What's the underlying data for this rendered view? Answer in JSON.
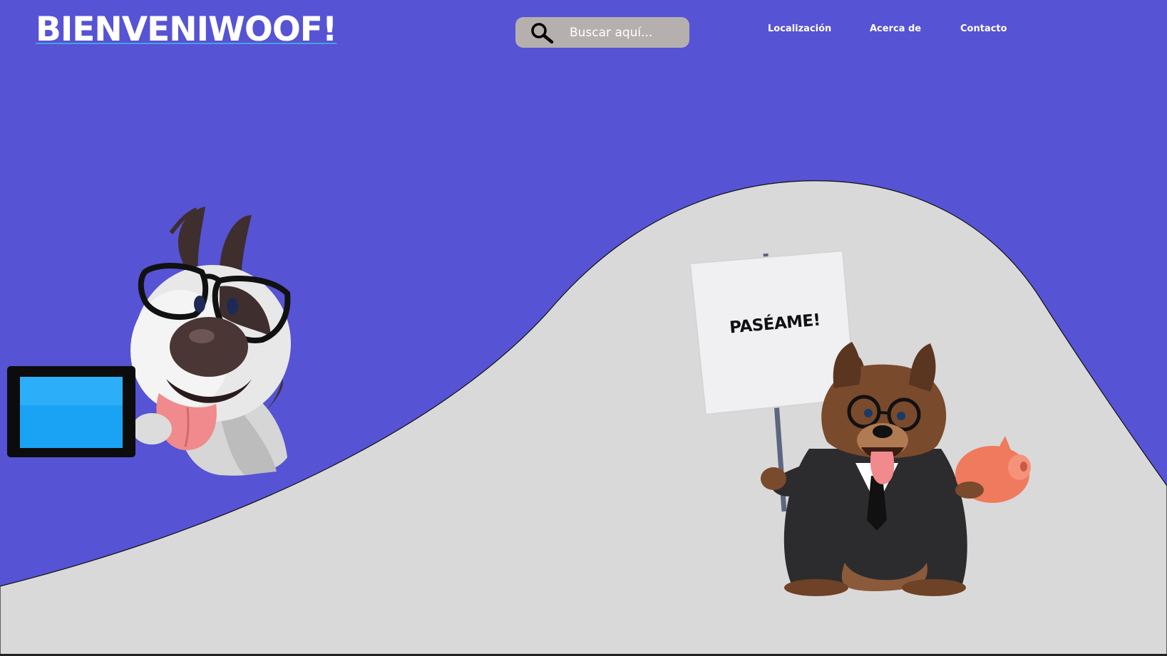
{
  "header": {
    "logo_text": "BIENVENIWOOF!",
    "search": {
      "placeholder": "Buscar aquí...",
      "value": "",
      "icon": "search-icon"
    },
    "nav": {
      "items": [
        {
          "label": "Localización"
        },
        {
          "label": "Acerca de"
        },
        {
          "label": "Contacto"
        }
      ]
    }
  },
  "hero": {
    "sign_text": "PASÉAME!",
    "left_illustration": "dog-with-glasses-and-tablet",
    "right_illustration": "shepherd-dog-in-suit-with-sign-and-piggy-bank"
  },
  "colors": {
    "background": "#5653d4",
    "hill": "#d9d9d9",
    "search_bg": "#b5b0ae",
    "text": "#ffffff"
  }
}
